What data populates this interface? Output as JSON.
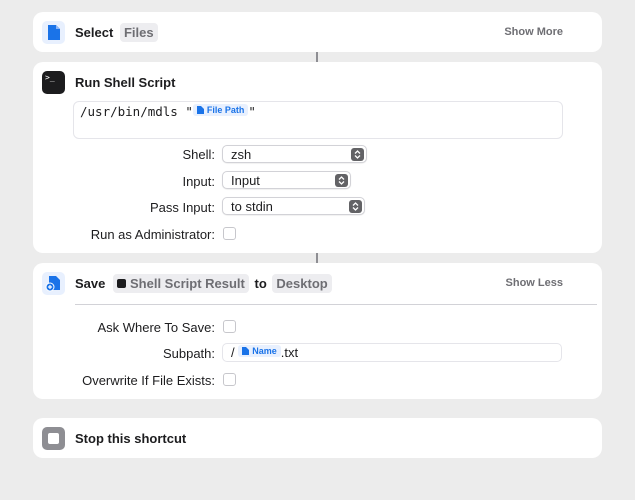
{
  "select_files": {
    "title": "Select",
    "token": "Files",
    "show_more": "Show More",
    "icon": "document-icon",
    "color": "#1a73e8"
  },
  "run_shell": {
    "title": "Run Shell Script",
    "icon": "terminal-icon",
    "script_text": "/usr/bin/mdls \"",
    "script_suffix": "\"",
    "variable": "File Path",
    "shell_label": "Shell:",
    "shell_value": "zsh",
    "input_label": "Input:",
    "input_value": "Input",
    "pass_input_label": "Pass Input:",
    "pass_input_value": "to stdin",
    "admin_label": "Run as Administrator:",
    "terminal_glyph": ">_"
  },
  "save": {
    "title": "Save",
    "token_result": "Shell Script Result",
    "to_label": "to",
    "token_destination": "Desktop",
    "show_less": "Show Less",
    "icon": "save-document-icon",
    "ask_label": "Ask Where To Save:",
    "subpath_label": "Subpath:",
    "subpath_prefix": "/",
    "subpath_variable": "Name",
    "subpath_suffix": ".txt",
    "overwrite_label": "Overwrite If File Exists:"
  },
  "stop": {
    "title": "Stop this shortcut",
    "icon": "stop-icon"
  }
}
